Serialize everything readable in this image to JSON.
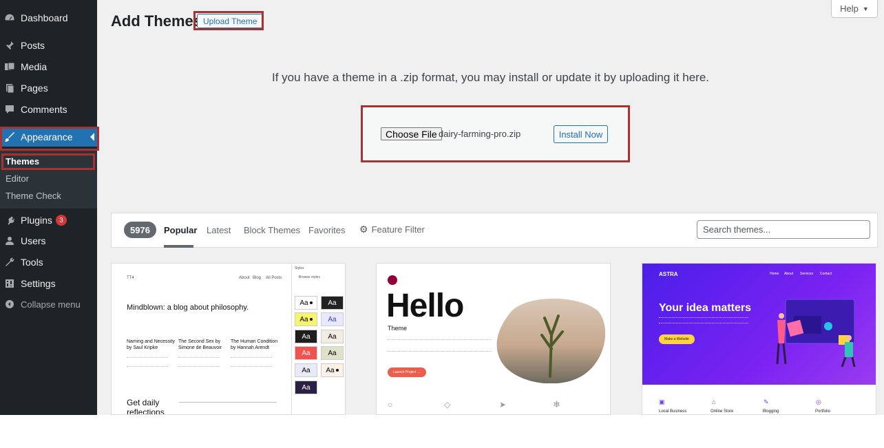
{
  "sidebar": {
    "items": [
      {
        "label": "Dashboard",
        "icon": "dashboard-icon"
      },
      {
        "label": "Posts",
        "icon": "pin-icon"
      },
      {
        "label": "Media",
        "icon": "media-icon"
      },
      {
        "label": "Pages",
        "icon": "pages-icon"
      },
      {
        "label": "Comments",
        "icon": "comment-icon"
      },
      {
        "label": "Appearance",
        "icon": "brush-icon"
      },
      {
        "label": "Plugins",
        "icon": "plug-icon",
        "badge": "3"
      },
      {
        "label": "Users",
        "icon": "user-icon"
      },
      {
        "label": "Tools",
        "icon": "wrench-icon"
      },
      {
        "label": "Settings",
        "icon": "settings-icon"
      },
      {
        "label": "Collapse menu",
        "icon": "collapse-icon"
      }
    ],
    "appearance_submenu": [
      "Themes",
      "Editor",
      "Theme Check"
    ]
  },
  "header": {
    "title": "Add Themes",
    "upload_button": "Upload Theme",
    "help": "Help"
  },
  "upload": {
    "instructions": "If you have a theme in a .zip format, you may install or update it by uploading it here.",
    "choose_file": "Choose File",
    "file_name": "dairy-farming-pro.zip",
    "install_button": "Install Now"
  },
  "filter": {
    "count": "5976",
    "tabs": [
      "Popular",
      "Latest",
      "Block Themes",
      "Favorites"
    ],
    "feature_filter": "Feature Filter",
    "search_placeholder": "Search themes..."
  },
  "themes": {
    "tt": {
      "site": "TT4",
      "nav": [
        "About",
        "Blog",
        "All Posts"
      ],
      "headline": "Mindblown: a blog about philosophy.",
      "posts": [
        {
          "title1": "Naming and Necessity",
          "title2": "by Saul Kripke"
        },
        {
          "title1": "The Second Sex by",
          "title2": "Simone de Beauvoir"
        },
        {
          "title1": "The Human Condition",
          "title2": "by Hannah Arendt"
        }
      ],
      "footer1": "Get daily",
      "footer2": "reflections",
      "panel_title": "Styles",
      "panel_sub": "Browse styles",
      "swatch": "Aa"
    },
    "hello": {
      "title": "Hello",
      "subtitle": "Theme",
      "button": "Launch Project →"
    },
    "astra": {
      "logo": "ASTRA",
      "nav": [
        "Home",
        "About",
        "Services",
        "Contact"
      ],
      "headline": "Your idea matters",
      "button": "Make a Website",
      "features": [
        "Local Business",
        "Online Store",
        "Blogging",
        "Portfolio"
      ]
    }
  },
  "colors": {
    "sidebar_bg": "#1d2327",
    "accent": "#2271b1",
    "highlight_box": "#a83232",
    "astra_purple": "#5b21f7",
    "plugin_badge": "#d63638"
  }
}
